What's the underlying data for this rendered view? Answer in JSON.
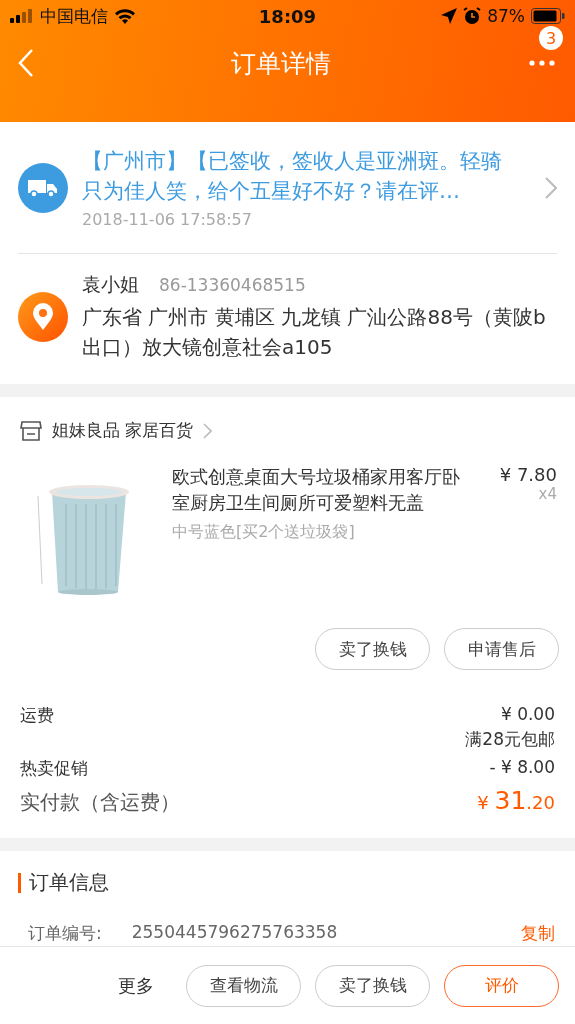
{
  "status_bar": {
    "carrier": "中国电信",
    "time": "18:09",
    "battery": "87%"
  },
  "nav": {
    "title": "订单详情",
    "badge": "3"
  },
  "logistics": {
    "message": "【广州市】【已签收，签收人是亚洲斑。轻骑只为佳人笑，给个五星好不好？请在评…",
    "time": "2018-11-06 17:58:57"
  },
  "address": {
    "name": "袁小姐",
    "phone": "86-13360468515",
    "detail": "广东省 广州市 黄埔区 九龙镇 广汕公路88号（黄陂b出口）放大镜创意社会a105"
  },
  "shop": {
    "name": "姐妹良品 家居百货"
  },
  "product": {
    "kind": "picture",
    "title": "欧式创意桌面大号垃圾桶家用客厅卧室厨房卫生间厕所可爱塑料无盖",
    "price": "¥ 7.80",
    "quantity": "x4",
    "variant": "中号蓝色[买2个送垃圾袋]"
  },
  "item_buttons": [
    "卖了换钱",
    "申请售后"
  ],
  "fees": [
    {
      "label": "运费",
      "value": "¥ 0.00",
      "note": "满28元包邮"
    },
    {
      "label": "热卖促销",
      "value": "- ¥ 8.00"
    }
  ],
  "total": {
    "label": "实付款（含运费）",
    "currency": "¥ ",
    "integer": "31",
    "decimal": ".20"
  },
  "order_info": {
    "title": "订单信息",
    "rows": [
      {
        "label": "订单编号:",
        "value": "2550445796275763358",
        "action": "复制"
      }
    ]
  },
  "bottom_bar": {
    "more": "更多",
    "buttons": [
      {
        "label": "查看物流",
        "primary": false
      },
      {
        "label": "卖了换钱",
        "primary": false
      },
      {
        "label": "评价",
        "primary": true
      }
    ]
  }
}
